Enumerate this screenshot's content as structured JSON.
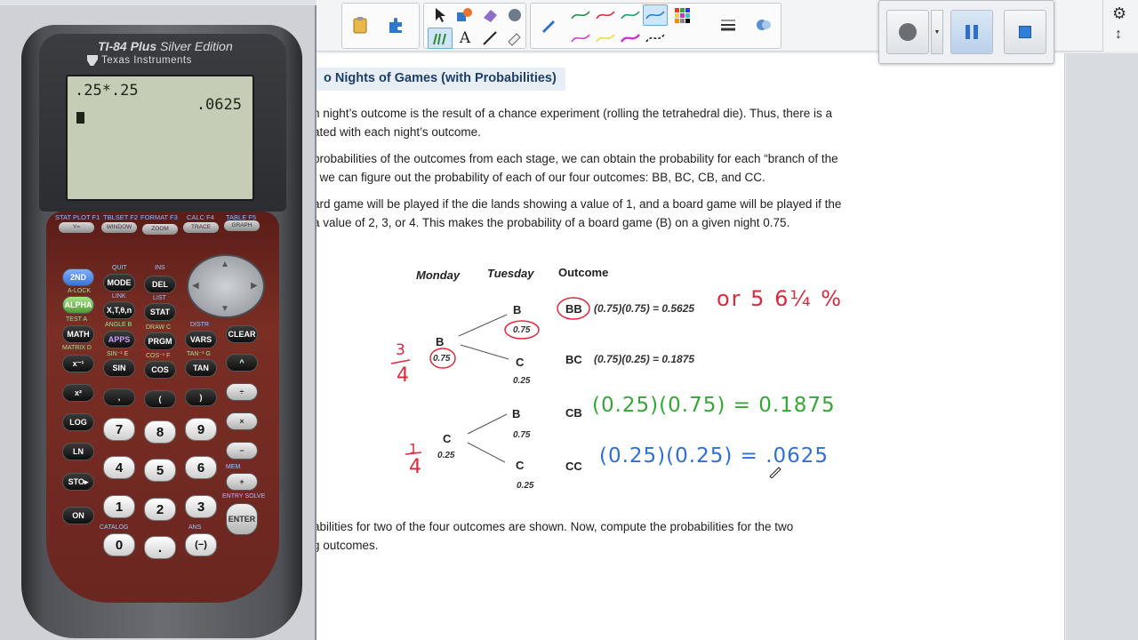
{
  "toolbar": {
    "tools": [
      {
        "name": "clipboard-icon"
      },
      {
        "name": "puzzle-icon"
      },
      {
        "name": "pointer-icon"
      },
      {
        "name": "shapes-icon"
      },
      {
        "name": "eraser-icon"
      },
      {
        "name": "hand-icon"
      },
      {
        "name": "pen-icon"
      },
      {
        "name": "text-icon"
      },
      {
        "name": "line-icon"
      },
      {
        "name": "highlighter-icon"
      },
      {
        "name": "color-palette-icon"
      },
      {
        "name": "line-style-icon"
      },
      {
        "name": "fill-icon"
      }
    ],
    "text_tool_label": "A",
    "pen_colors": [
      "#2e8b57",
      "#d8334a",
      "#22a06b",
      "#2a7fc9",
      "#cc44cc",
      "#e6e04a",
      "#cc33cc",
      "#222222"
    ]
  },
  "recorder": {
    "record_icon": "record-icon",
    "pause_icon": "pause-icon",
    "stop_icon": "stop-icon"
  },
  "side_tools": {
    "settings_icon": "gear-icon",
    "resize_icon": "resize-vertical-icon"
  },
  "document": {
    "heading": "o Nights of Games (with Probabilities)",
    "paragraphs": [
      "n night’s outcome is the result of a chance experiment (rolling the tetrahedral die).  Thus, there is a",
      "ated with each night’s outcome.",
      "probabilities of the outcomes from each stage, we can obtain the probability for each “branch of the",
      ", we can figure out the probability of each of our four outcomes:  BB, BC, CB, and CC.",
      "ard game will be played if the die lands showing a value of 1, and a board game will be played if the",
      "a value of 2, 3, or 4.  This makes the probability of a board game (B) on a given night 0.75.",
      "abilities for two of the four outcomes are shown.  Now, compute the probabilities for the two",
      "g outcomes."
    ],
    "tree": {
      "col_monday": "Monday",
      "col_tuesday": "Tuesday",
      "col_outcome": "Outcome",
      "monday_b": "B",
      "monday_b_prob": "0.75",
      "monday_c": "C",
      "monday_c_prob": "0.25",
      "tue_bb": "B",
      "tue_bb_prob": "0.75",
      "tue_bc": "C",
      "tue_bc_prob": "0.25",
      "tue_cb": "B",
      "tue_cb_prob": "0.75",
      "tue_cc": "C",
      "tue_cc_prob": "0.25",
      "outcomes": [
        {
          "label": "BB",
          "calc": "(0.75)(0.75) = 0.5625"
        },
        {
          "label": "BC",
          "calc": "(0.75)(0.25) = 0.1875"
        },
        {
          "label": "CB",
          "calc": ""
        },
        {
          "label": "CC",
          "calc": ""
        }
      ]
    },
    "annotations": {
      "frac_three_quarters_num": "3",
      "frac_three_quarters_den": "4",
      "frac_one_quarter_num": "1",
      "frac_one_quarter_den": "4",
      "bb_alt": "or 5 6¼ %",
      "cb_work": "(0.25)(0.75) = 0.1875",
      "cc_work": "(0.25)(0.25) = .0625"
    }
  },
  "calculator": {
    "model": "TI-84 Plus",
    "edition": "Silver Edition",
    "maker": "Texas Instruments",
    "screen_input": ".25*.25",
    "screen_result": ".0625",
    "fkey_labels": [
      "STAT PLOT F1",
      "TBLSET F2",
      "FORMAT F3",
      "CALC F4",
      "TABLE F5"
    ],
    "fkeys": [
      "Y=",
      "WINDOW",
      "ZOOM",
      "TRACE",
      "GRAPH"
    ],
    "row1_labels": [
      "QUIT",
      "INS"
    ],
    "row1": [
      "2ND",
      "MODE",
      "DEL"
    ],
    "row2_labels": [
      "A-LOCK",
      "LINK",
      "LIST"
    ],
    "row2": [
      "ALPHA",
      "X,T,θ,n",
      "STAT"
    ],
    "row3_labels": [
      "TEST A",
      "ANGLE B",
      "DRAW C",
      "DISTR"
    ],
    "row3": [
      "MATH",
      "APPS",
      "PRGM",
      "VARS",
      "CLEAR"
    ],
    "row4_labels": [
      "MATRIX D",
      "SIN⁻¹ E",
      "COS⁻¹ F",
      "TAN⁻¹ G"
    ],
    "row4": [
      "x⁻¹",
      "SIN",
      "COS",
      "TAN",
      "^"
    ],
    "row5": [
      "x²",
      ",",
      "(",
      ")",
      "÷"
    ],
    "row6": [
      "LOG",
      "7",
      "8",
      "9",
      "×"
    ],
    "row7": [
      "LN",
      "4",
      "5",
      "6",
      "−"
    ],
    "row8": [
      "STO▸",
      "1",
      "2",
      "3",
      "+"
    ],
    "row9": [
      "ON",
      "0",
      ".",
      "(−)",
      "ENTER"
    ],
    "mem_label": "MEM",
    "entry_label": "ENTRY SOLVE",
    "catalog_label": "CATALOG",
    "ans_label": "ANS"
  }
}
